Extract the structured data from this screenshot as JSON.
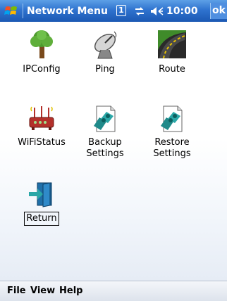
{
  "titlebar": {
    "title": "Network Menu",
    "notification_count": "1",
    "time": "10:00",
    "ok_label": "ok"
  },
  "tiles": [
    {
      "label": "IPConfig",
      "icon": "tree-icon"
    },
    {
      "label": "Ping",
      "icon": "satellite-dish-icon"
    },
    {
      "label": "Route",
      "icon": "road-icon"
    },
    {
      "label": "WiFiStatus",
      "icon": "wifi-router-icon"
    },
    {
      "label": "Backup\nSettings",
      "icon": "settings-document-icon"
    },
    {
      "label": "Restore\nSettings",
      "icon": "settings-document-icon"
    },
    {
      "label": "Return",
      "icon": "exit-door-icon"
    }
  ],
  "menubar": {
    "file": "File",
    "view": "View",
    "help": "Help"
  }
}
